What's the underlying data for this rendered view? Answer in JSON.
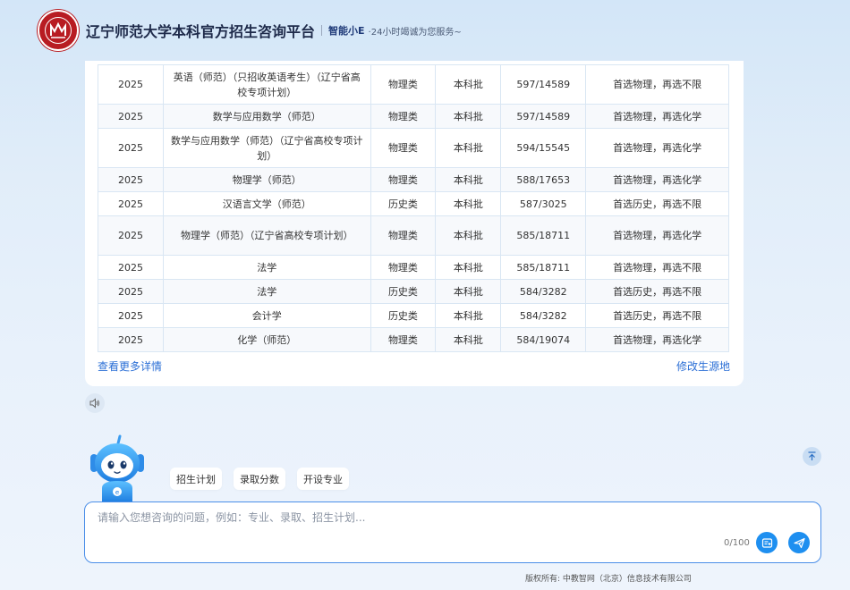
{
  "header": {
    "title": "辽宁师范大学本科官方招生咨询平台",
    "assistant_name": "智能小E",
    "assistant_sub": "·24小时竭诚为您服务~",
    "logo_icon": "university-seal"
  },
  "table": {
    "rows": [
      {
        "year": "2025",
        "major": "英语（师范）（只招收英语考生）（辽宁省高校专项计划）",
        "type": "物理类",
        "batch": "本科批",
        "score": "597/14589",
        "req": "首选物理，再选不限"
      },
      {
        "year": "2025",
        "major": "数学与应用数学（师范）",
        "type": "物理类",
        "batch": "本科批",
        "score": "597/14589",
        "req": "首选物理，再选化学"
      },
      {
        "year": "2025",
        "major": "数学与应用数学（师范）（辽宁省高校专项计划）",
        "type": "物理类",
        "batch": "本科批",
        "score": "594/15545",
        "req": "首选物理，再选化学"
      },
      {
        "year": "2025",
        "major": "物理学（师范）",
        "type": "物理类",
        "batch": "本科批",
        "score": "588/17653",
        "req": "首选物理，再选化学"
      },
      {
        "year": "2025",
        "major": "汉语言文学（师范）",
        "type": "历史类",
        "batch": "本科批",
        "score": "587/3025",
        "req": "首选历史，再选不限"
      },
      {
        "year": "2025",
        "major": "物理学（师范）（辽宁省高校专项计划）",
        "type": "物理类",
        "batch": "本科批",
        "score": "585/18711",
        "req": "首选物理，再选化学"
      },
      {
        "year": "2025",
        "major": "法学",
        "type": "物理类",
        "batch": "本科批",
        "score": "585/18711",
        "req": "首选物理，再选不限"
      },
      {
        "year": "2025",
        "major": "法学",
        "type": "历史类",
        "batch": "本科批",
        "score": "584/3282",
        "req": "首选历史，再选不限"
      },
      {
        "year": "2025",
        "major": "会计学",
        "type": "历史类",
        "batch": "本科批",
        "score": "584/3282",
        "req": "首选历史，再选不限"
      },
      {
        "year": "2025",
        "major": "化学（师范）",
        "type": "物理类",
        "batch": "本科批",
        "score": "584/19074",
        "req": "首选物理，再选化学"
      }
    ]
  },
  "links": {
    "more": "查看更多详情",
    "change": "修改生源地"
  },
  "quick": [
    "招生计划",
    "录取分数",
    "开设专业"
  ],
  "input": {
    "placeholder": "请输入您想咨询的问题，例如：专业、录取、招生计划...",
    "counter": "0/100"
  },
  "footer": "版权所有: 中教智网（北京）信息技术有限公司",
  "colors": {
    "accent": "#1e8ff0",
    "link": "#2b6fd6",
    "brand_red": "#b81c22"
  }
}
